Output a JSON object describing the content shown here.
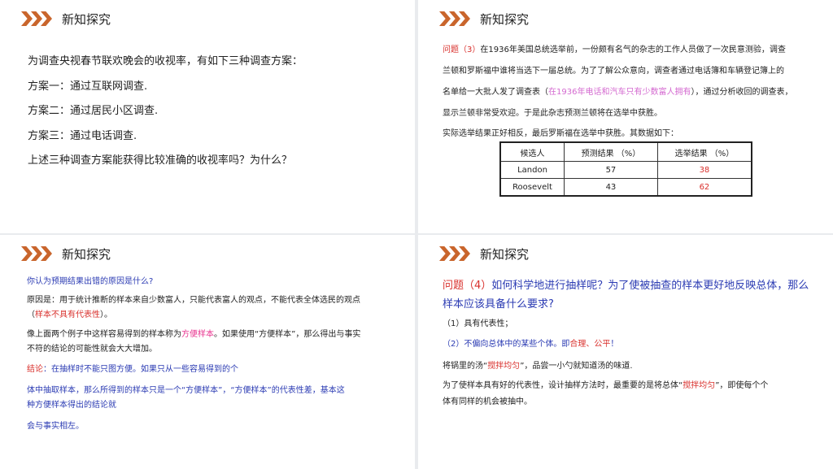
{
  "slide1": {
    "title": "新知探究",
    "lines": [
      "为调查央视春节联欢晚会的收视率，有如下三种调查方案：",
      "方案一：通过互联网调查.",
      "方案二：通过居民小区调查.",
      "方案三：通过电话调查.",
      "上述三种调查方案能获得比较准确的收视率吗？为什么？"
    ]
  },
  "slide2": {
    "title": "新知探究",
    "q_label": "问题（3）",
    "p1": "在1936年美国总统选举前，一份颇有名气的杂志的工作人员做了一次民意测验，调查",
    "p2": "兰顿和罗斯福中谁将当选下一届总统。为了了解公众意向，调查者通过电话簿和车辆登记簿上的",
    "p3a": "名单给一大批人发了调查表（",
    "p3b": "在1936年电话和汽车只有少数富人拥有",
    "p3c": "），通过分析收回的调查表，",
    "p4": "显示兰顿非常受欢迎。于是此杂志预测兰顿将在选举中获胜。",
    "p5": "实际选举结果正好相反，最后罗斯福在选举中获胜。其数据如下：",
    "table": {
      "headers": [
        "候选人",
        "预测结果 （%）",
        "选举结果 （%）"
      ],
      "rows": [
        [
          "Landon",
          "57",
          "38"
        ],
        [
          "Roosevelt",
          "43",
          "62"
        ]
      ]
    }
  },
  "slide3": {
    "title": "新知探究",
    "q": "你认为预期结果出错的原因是什么?",
    "r1": "原因是：用于统计推断的样本来自少数富人，只能代表富人的观点，不能代表全体选民的观点",
    "r2a": "（",
    "r2b": "样本不具有代表性",
    "r2c": "）。",
    "c1a": "像上面两个例子中这样容易得到的样本称为",
    "c1b": "方便样本",
    "c1c": "。如果使用“方便样本”，那么得出与事实",
    "c2": "不符的结论的可能性就会大大增加。",
    "k1a": "结论",
    "k1b": "：在抽样时不能只图方便。如果只从一些容易得到的个",
    "k2": "体中抽取样本，那么所得到的样本只是一个“方便样本”，“方便样本”的代表性差，基本这",
    "k3": "种方便样本得出的结论就",
    "k4": "会与事实相左。"
  },
  "slide4": {
    "title": "新知探究",
    "q1a": "问题（4）",
    "q1b": "如何科学地进行抽样呢？为了使被抽查的样本更好地反映总体，那么",
    "q2": "样本应该具备什么要求?",
    "a1": "（1）具有代表性；",
    "a2a": "（2）不偏向总体中的某些个体。即",
    "a2b": "合理、公平",
    "a2c": "！",
    "b1a": "将锅里的汤“",
    "b1b": "搅拌均匀",
    "b1c": "”，品尝一小勺就知道汤的味道.",
    "b2a": "为了使样本具有好的代表性，设计抽样方法时，最重要的是将总体“",
    "b2b": "搅拌均匀",
    "b2c": "”，即使每个个",
    "b3": "体有同样的机会被抽中。"
  }
}
